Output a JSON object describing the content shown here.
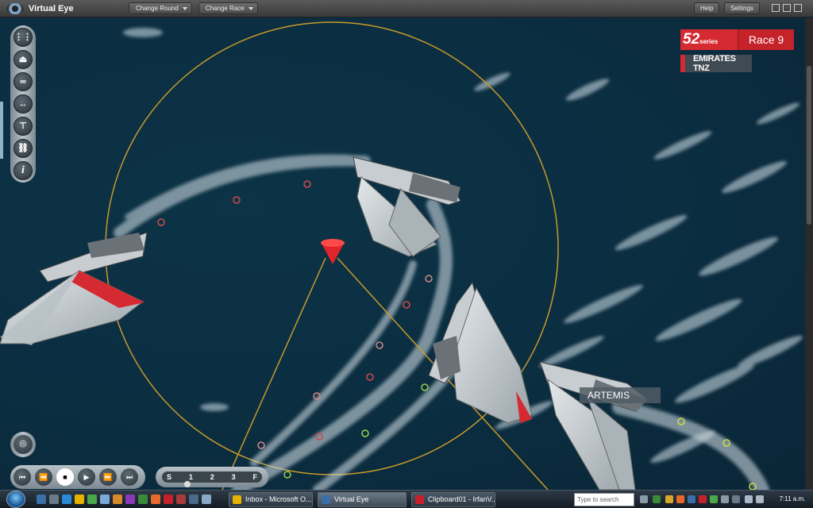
{
  "titlebar": {
    "app_title": "Virtual Eye",
    "dropdowns": [
      "Change Round",
      "Change Race"
    ],
    "buttons": [
      "Help",
      "Settings"
    ]
  },
  "race": {
    "series_logo": "52",
    "series_word": "series",
    "race_label": "Race 9"
  },
  "team_badge": "EMIRATES TNZ",
  "boat_label": "ARTEMIS",
  "tools": [
    "sail-spacing-icon",
    "boat-icon",
    "binoculars-icon",
    "distance-icon",
    "layline-icon",
    "chain-icon",
    "info-icon"
  ],
  "info_glyph": "i",
  "playback": {
    "buttons": [
      "skip-start-icon",
      "rewind-icon",
      "stop-icon",
      "play-icon",
      "fast-forward-icon",
      "skip-end-icon"
    ],
    "speed_marks": [
      "S",
      "1",
      "2",
      "3",
      "F"
    ]
  },
  "taskbar": {
    "items": [
      {
        "label": "Inbox - Microsoft O...",
        "color": "#e8b200"
      },
      {
        "label": "Virtual Eye",
        "color": "#3a6fa8",
        "active": true
      },
      {
        "label": "Clipboard01 - IrfanV...",
        "color": "#c8202a"
      }
    ],
    "search_placeholder": "Type to search",
    "clock": "7:11 a.m."
  },
  "colors": {
    "ocean": "#0b2d40",
    "accent_red": "#d62a32",
    "mark_line": "#c89a2a"
  }
}
